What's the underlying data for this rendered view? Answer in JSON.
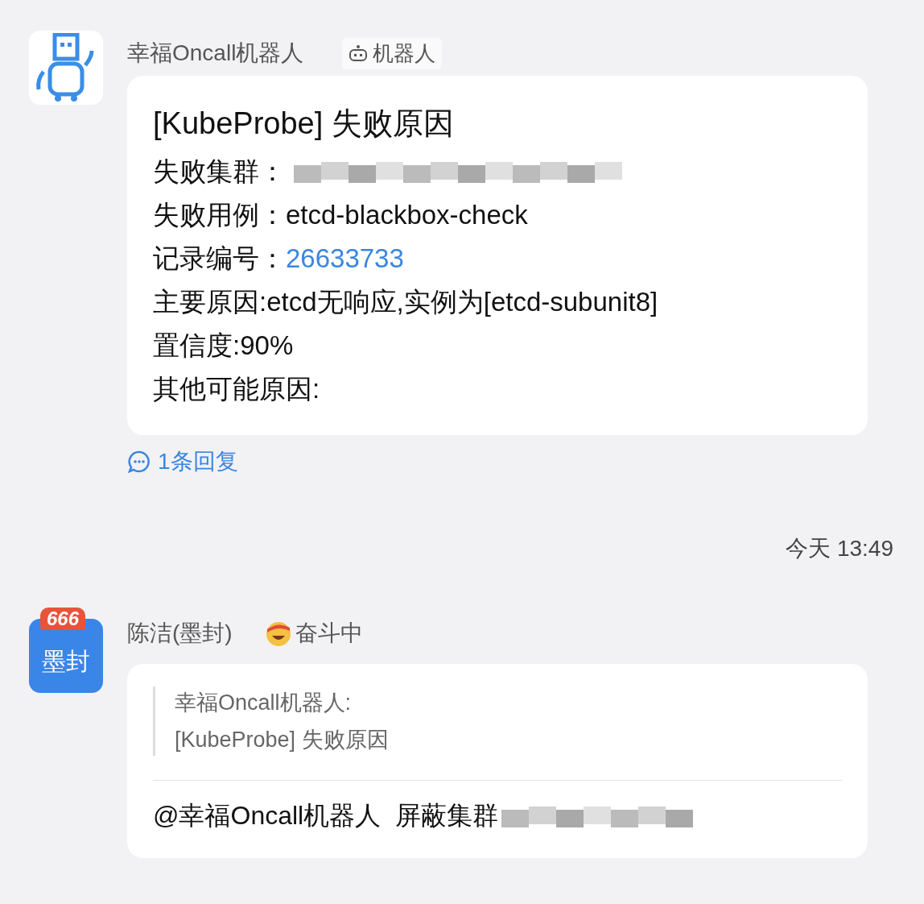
{
  "messages": [
    {
      "kind": "bot",
      "sender": "幸福Oncall机器人",
      "tag": "机器人",
      "card": {
        "title": "[KubeProbe] 失败原因",
        "rows": [
          {
            "label": "失败集群：",
            "kind": "redacted"
          },
          {
            "label": "失败用例：",
            "value": "etcd-blackbox-check",
            "kind": "text"
          },
          {
            "label": "记录编号：",
            "value": "26633733",
            "kind": "link"
          },
          {
            "label": "主要原因: ",
            "value": "etcd无响应,实例为[etcd-subunit8]",
            "kind": "text"
          },
          {
            "label": "置信度: ",
            "value": "90%",
            "kind": "text"
          },
          {
            "label": "其他可能原因:",
            "kind": "empty"
          }
        ]
      },
      "reply_link": "1条回复"
    },
    {
      "kind": "time",
      "time": "今天 13:49"
    },
    {
      "kind": "user",
      "sender": "陈洁(墨封)",
      "avatar_badge": "666",
      "avatar_text": "墨封",
      "status": "奋斗中",
      "quote": {
        "author": "幸福Oncall机器人:",
        "text": "[KubeProbe] 失败原因"
      },
      "parts": [
        {
          "kind": "mention",
          "text": "@幸福Oncall机器人"
        },
        {
          "kind": "text",
          "text": "屏蔽集群"
        },
        {
          "kind": "redacted"
        }
      ]
    }
  ]
}
